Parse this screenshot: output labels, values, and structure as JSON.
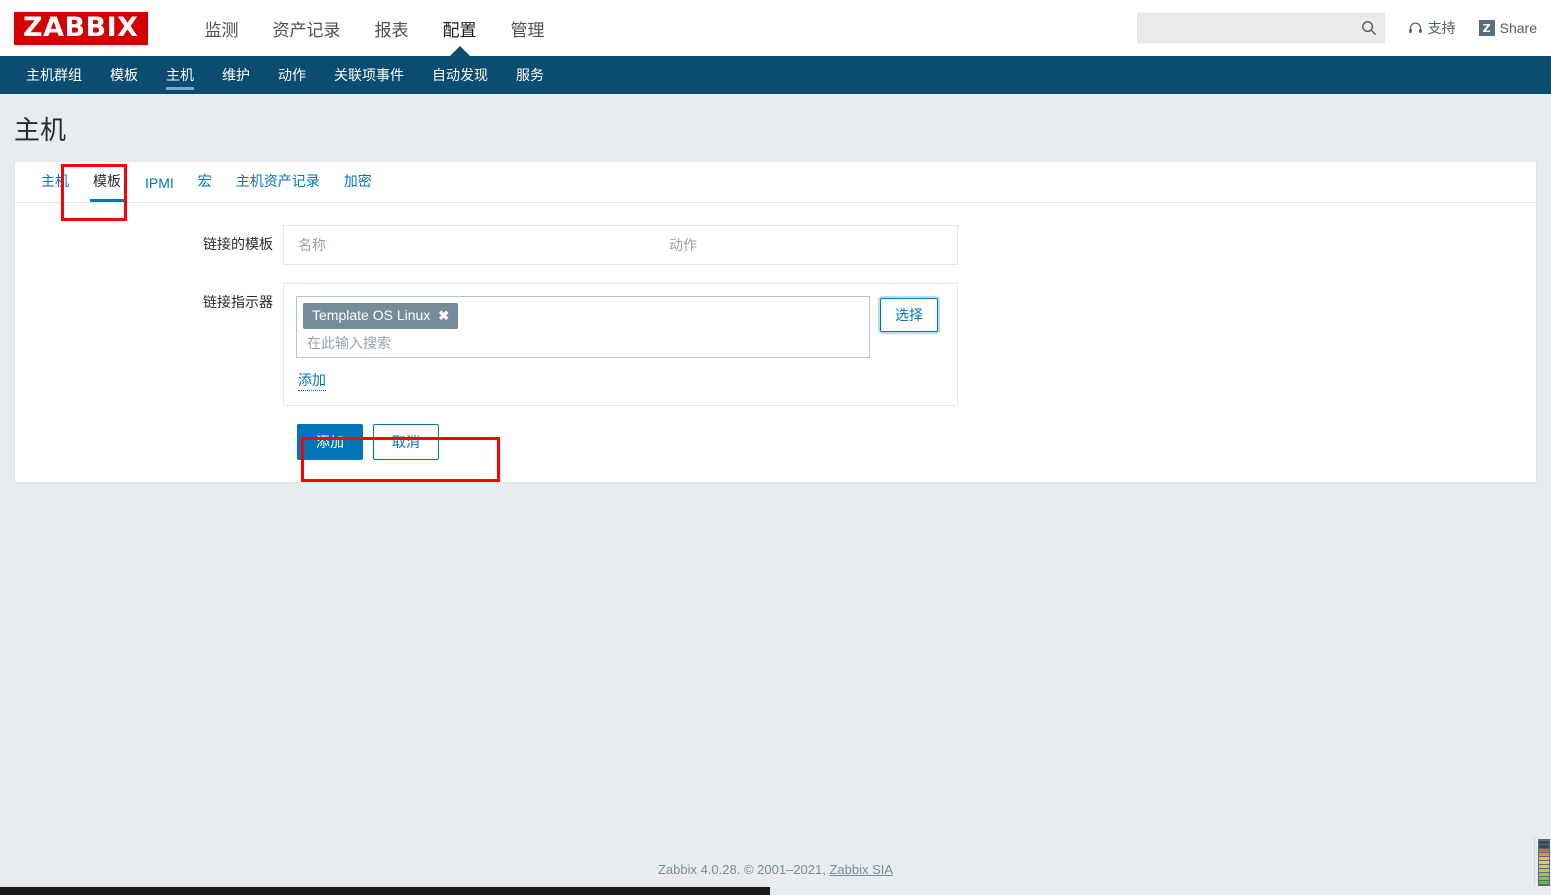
{
  "header": {
    "logo": "ZABBIX",
    "main_nav": [
      {
        "label": "监测",
        "active": false
      },
      {
        "label": "资产记录",
        "active": false
      },
      {
        "label": "报表",
        "active": false
      },
      {
        "label": "配置",
        "active": true
      },
      {
        "label": "管理",
        "active": false
      }
    ],
    "search": {
      "value": "",
      "placeholder": "",
      "icon": "search-icon"
    },
    "support_label": "支持",
    "support_icon": "headset-icon",
    "share_label": "Share",
    "share_badge": "Z"
  },
  "subnav": {
    "items": [
      {
        "label": "主机群组",
        "active": false
      },
      {
        "label": "模板",
        "active": false
      },
      {
        "label": "主机",
        "active": true
      },
      {
        "label": "维护",
        "active": false
      },
      {
        "label": "动作",
        "active": false
      },
      {
        "label": "关联项事件",
        "active": false
      },
      {
        "label": "自动发现",
        "active": false
      },
      {
        "label": "服务",
        "active": false
      }
    ]
  },
  "page": {
    "title": "主机"
  },
  "tabs": [
    {
      "label": "主机",
      "active": false
    },
    {
      "label": "模板",
      "active": true
    },
    {
      "label": "IPMI",
      "active": false
    },
    {
      "label": "宏",
      "active": false
    },
    {
      "label": "主机资产记录",
      "active": false
    },
    {
      "label": "加密",
      "active": false
    }
  ],
  "form": {
    "linked_templates": {
      "label": "链接的模板",
      "col_name": "名称",
      "col_action": "动作"
    },
    "link_new": {
      "label": "链接指示器",
      "chips": [
        {
          "text": "Template OS Linux",
          "close_icon": "close-icon"
        }
      ],
      "input_value": "",
      "input_placeholder": "在此输入搜索",
      "select_button": "选择",
      "add_link": "添加"
    },
    "actions": {
      "submit": "添加",
      "cancel": "取消"
    }
  },
  "footer": {
    "text": "Zabbix 4.0.28. © 2001–2021, ",
    "link": "Zabbix SIA"
  },
  "colors": {
    "brand_red": "#d40000",
    "nav_dark": "#0c4c70",
    "accent_blue": "#0275b8",
    "chip_bg": "#768d99",
    "highlight_red": "#ff0000",
    "page_bg": "#e8ecef"
  }
}
